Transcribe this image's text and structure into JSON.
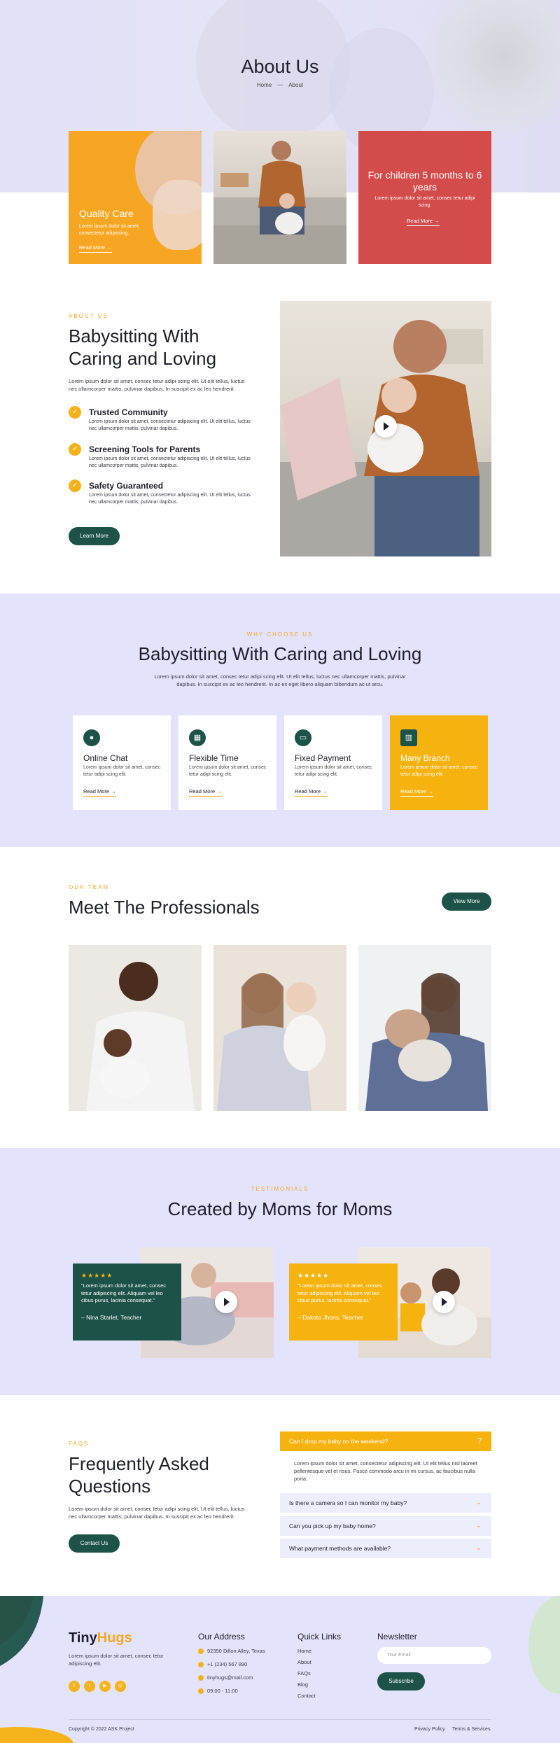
{
  "hero": {
    "title": "About Us",
    "breadcrumb_home": "Home",
    "breadcrumb_sep": "—",
    "breadcrumb_current": "About"
  },
  "services": [
    {
      "title": "Quality Care",
      "text": "Lorem ipsum dolor sit amet, consectetur adipiscing.",
      "link": "Read More"
    },
    {
      "title": "For children 5 months to 6 years",
      "text": "Lorem ipsum dolor sit amet, consec tetur adipi scing.",
      "link": "Read More"
    }
  ],
  "about": {
    "eyebrow": "ABOUT US",
    "title_line1": "Babysitting With",
    "title_line2": "Caring and Loving",
    "intro": "Lorem ipsum dolor sit amet, consec tetur adipi scing elit. Ut elit tellus, luctus nec ullamcorper mattis, pulvinar dapibus. In suscipit ex ac leo hendrerit.",
    "features": [
      {
        "title": "Trusted Community",
        "text": "Lorem ipsum dolor sit amet, consectetur adipiscing elit. Ut elit tellus, luctus nec ullamcorper mattis, pulvinar dapibus."
      },
      {
        "title": "Screening Tools for Parents",
        "text": "Lorem ipsum dolor sit amet, consectetur adipiscing elit. Ut elit tellus, luctus nec ullamcorper mattis, pulvinar dapibus."
      },
      {
        "title": "Safety Guaranteed",
        "text": "Lorem ipsum dolor sit amet, consectetur adipiscing elit. Ut elit tellus, luctus nec ullamcorper mattis, pulvinar dapibus."
      }
    ],
    "button": "Learn More"
  },
  "why": {
    "eyebrow": "WHY CHOOSE US",
    "title": "Babysitting With Caring and Loving",
    "intro": "Lorem ipsum dolor sit amet, consec tetur adipi scing elit. Ut elit tellus, luctus nec ullamcorper mattis, pulvinar dapibus. In suscipit ex ac leo hendrerit. In ac ex eget libero aliquam bibendum ac ut arcu.",
    "cards": [
      {
        "title": "Online Chat",
        "text": "Lorem ipsum dolor sit amet, consec tetur adipi scing elit.",
        "link": "Read More",
        "icon": "chat-icon"
      },
      {
        "title": "Flexible Time",
        "text": "Lorem ipsum dolor sit amet, consec tetur adipi scing elit.",
        "link": "Read More",
        "icon": "calendar-icon"
      },
      {
        "title": "Fixed Payment",
        "text": "Lorem ipsum dolor sit amet, consec tetur adipi scing elit.",
        "link": "Read More",
        "icon": "wallet-icon"
      },
      {
        "title": "Many Branch",
        "text": "Lorem ipsum dolor sit amet, consec tetur adipi scing elit.",
        "link": "Read More",
        "icon": "building-icon"
      }
    ]
  },
  "team": {
    "eyebrow": "OUR TEAM",
    "title": "Meet The Professionals",
    "button": "View More"
  },
  "testimonials": {
    "eyebrow": "TESTIMONIALS",
    "title": "Created by Moms for Moms",
    "items": [
      {
        "stars": "★★★★★",
        "quote": "\"Lorem ipsum dolor sit amet, consec tetur adipiscing elit. Aliquam vel leo cibus purus, lacinia consequat.\"",
        "name": "– Nina Starlet, Teacher"
      },
      {
        "stars": "★★★★★",
        "quote": "\"Lorem ipsum dolor sit amet, consec tetur adipiscing elit. Aliquam vel leo cibus purus, lacinia consequat.\"",
        "name": "– Dakota Jhons, Teacher"
      }
    ]
  },
  "faq": {
    "eyebrow": "FAQS",
    "title_line1": "Frequently Asked",
    "title_line2": "Questions",
    "intro": "Lorem ipsum dolor sit amet, consec tetur adipi scing elit. Ut elit tellus, luctus nec ullamcorper mattis, pulvinar dapibus. In suscipit ex ac leo hendrerit.",
    "button": "Contact Us",
    "open_question": "Can I drop my baby on the weekend?",
    "open_answer": "Lorem ipsum dolor sit amet, consectetur adipiscing elit. Ut elit tellus nisl laoreet pellentesque vel et risus. Fusce commodo arcu in mi cursus, ac faucibus nulla porta.",
    "questions": [
      "Is there a camera so I can monitor my baby?",
      "Can you pick up my baby home?",
      "What payment methods are available?"
    ]
  },
  "footer": {
    "brand_a": "Tiny",
    "brand_b": "Hugs",
    "about": "Lorem ipsum dolor sit amet, consec tetur adipiscing elit.",
    "address_title": "Our Address",
    "address": [
      "92350 Dillon Alley, Texas",
      "+1 (234) 567 890",
      "tinyhugs@mail.com",
      "09:00 - 11:00"
    ],
    "links_title": "Quick Links",
    "links": [
      "Home",
      "About",
      "FAQs",
      "Blog",
      "Contact"
    ],
    "newsletter_title": "Newsletter",
    "newsletter_placeholder": "Your Email",
    "subscribe": "Subscribe",
    "copyright": "Copyright © 2022 ASK Project",
    "privacy": "Privacy Policy",
    "terms": "Terms & Services"
  },
  "colors": {
    "accent": "#f6a623",
    "green": "#1c5247",
    "red": "#d44b4b",
    "lavender": "#e3e4fb"
  }
}
